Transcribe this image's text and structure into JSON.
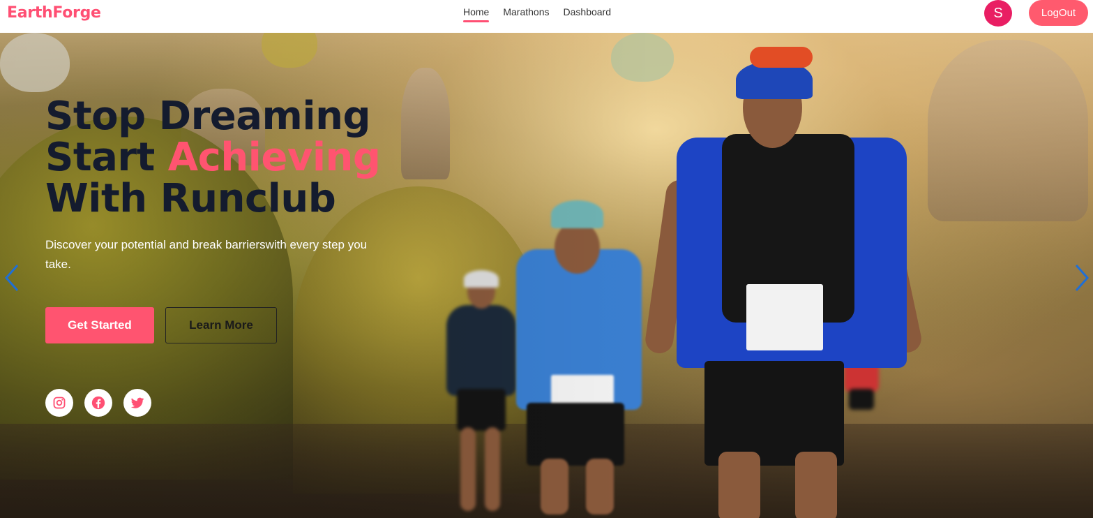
{
  "brand": "EarthForge",
  "nav": {
    "items": [
      {
        "label": "Home",
        "active": true
      },
      {
        "label": "Marathons",
        "active": false
      },
      {
        "label": "Dashboard",
        "active": false
      }
    ]
  },
  "user": {
    "avatar_initial": "S",
    "logout_label": "LogOut"
  },
  "hero": {
    "title_line1": "Stop Dreaming",
    "title_line2_prefix": "Start ",
    "title_line2_accent": "Achieving",
    "title_line3": "With Runclub",
    "subtitle": "Discover your potential and break barrierswith every step you take.",
    "primary_cta": "Get Started",
    "secondary_cta": "Learn More"
  },
  "social": [
    {
      "icon": "instagram-icon"
    },
    {
      "icon": "facebook-icon"
    },
    {
      "icon": "twitter-icon"
    }
  ],
  "carousel": {
    "prev_icon": "chevron-left-icon",
    "next_icon": "chevron-right-icon"
  },
  "colors": {
    "accent": "#ff5470",
    "brand": "#ff4f73",
    "avatar": "#e91e63",
    "title": "#141b2e",
    "arrow": "#1f6fd6"
  }
}
